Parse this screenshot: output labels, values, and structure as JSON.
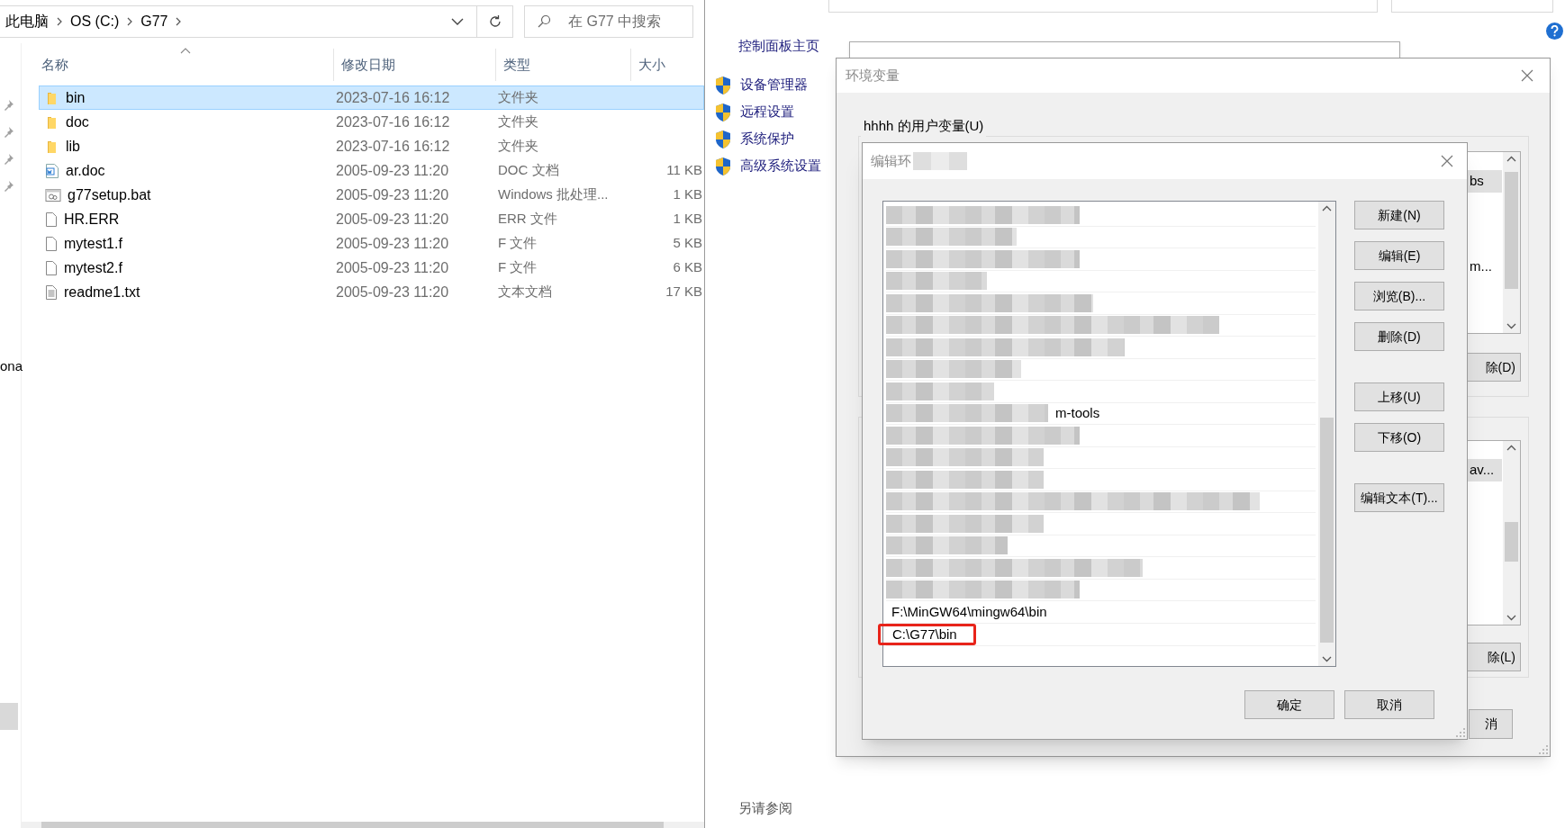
{
  "explorer": {
    "breadcrumbs": [
      "此电脑",
      "OS (C:)",
      "G77"
    ],
    "search": {
      "placeholder": "在 G77 中搜索"
    },
    "nav_fragment": "ona",
    "columns": [
      "名称",
      "修改日期",
      "类型",
      "大小"
    ],
    "files": [
      {
        "name": "bin",
        "kind": "folder",
        "date": "2023-07-16 16:12",
        "type": "文件夹",
        "selected": true
      },
      {
        "name": "doc",
        "kind": "folder",
        "date": "2023-07-16 16:12",
        "type": "文件夹",
        "selected": false
      },
      {
        "name": "lib",
        "kind": "folder",
        "date": "2023-07-16 16:12",
        "type": "文件夹",
        "selected": false
      },
      {
        "name": "ar.doc",
        "kind": "word",
        "date": "2005-09-23 11:20",
        "type": "DOC 文档",
        "size": "11 KB",
        "selected": false
      },
      {
        "name": "g77setup.bat",
        "kind": "batch",
        "date": "2005-09-23 11:20",
        "type": "Windows 批处理...",
        "size": "1 KB",
        "selected": false
      },
      {
        "name": "HR.ERR",
        "kind": "file",
        "date": "2005-09-23 11:20",
        "type": "ERR 文件",
        "size": "1 KB",
        "selected": false
      },
      {
        "name": "mytest1.f",
        "kind": "file",
        "date": "2005-09-23 11:20",
        "type": "F 文件",
        "size": "5 KB",
        "selected": false
      },
      {
        "name": "mytest2.f",
        "kind": "file",
        "date": "2005-09-23 11:20",
        "type": "F 文件",
        "size": "6 KB",
        "selected": false
      },
      {
        "name": "readme1.txt",
        "kind": "text",
        "date": "2005-09-23 11:20",
        "type": "文本文档",
        "size": "17 KB",
        "selected": false
      }
    ]
  },
  "control_panel": {
    "home_link": "控制面板主页",
    "links": [
      "设备管理器",
      "远程设置",
      "系统保护",
      "高级系统设置"
    ],
    "see_also": "另请参阅"
  },
  "env_dialog": {
    "title": "环境变量",
    "user_group": "hhhh 的用户变量(U)",
    "user_rows": [
      {
        "text": "bs",
        "selected": true
      },
      {
        "text": "m...",
        "selected": false
      }
    ],
    "user_button": "除(D)",
    "system_rows": [
      {
        "text": "av...",
        "selected": true
      }
    ],
    "system_button": "除(L)",
    "cancel_fragment": "消"
  },
  "edit_dialog": {
    "title": "编辑环",
    "entries": [
      {
        "kind": "redacted"
      },
      {
        "kind": "redacted"
      },
      {
        "kind": "redacted"
      },
      {
        "kind": "redacted"
      },
      {
        "kind": "redacted"
      },
      {
        "kind": "redacted"
      },
      {
        "kind": "redacted"
      },
      {
        "kind": "redacted"
      },
      {
        "kind": "redacted"
      },
      {
        "kind": "partial",
        "text": "m-tools"
      },
      {
        "kind": "redacted"
      },
      {
        "kind": "redacted"
      },
      {
        "kind": "redacted"
      },
      {
        "kind": "redacted"
      },
      {
        "kind": "redacted"
      },
      {
        "kind": "redacted"
      },
      {
        "kind": "redacted"
      },
      {
        "kind": "redacted"
      },
      {
        "kind": "text",
        "text": "F:\\MinGW64\\mingw64\\bin",
        "annotated": false
      },
      {
        "kind": "text",
        "text": "C:\\G77\\bin",
        "annotated": true
      }
    ],
    "button_groups": [
      [
        "新建(N)",
        "编辑(E)",
        "浏览(B)...",
        "删除(D)"
      ],
      [
        "上移(U)",
        "下移(O)"
      ],
      [
        "编辑文本(T)..."
      ]
    ],
    "ok": "确定",
    "cancel": "取消"
  }
}
